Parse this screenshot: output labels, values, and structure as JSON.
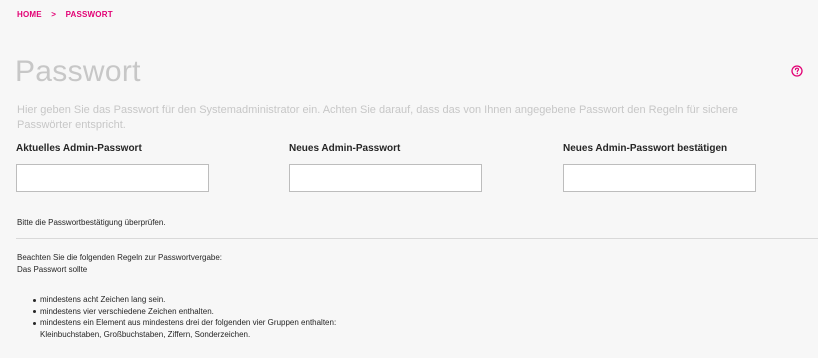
{
  "breadcrumb": {
    "home": "HOME",
    "separator": ">",
    "current": "PASSWORT"
  },
  "page": {
    "title": "Passwort",
    "intro": "Hier geben Sie das Passwort für den Systemadministrator ein. Achten Sie darauf, dass das von Ihnen angegebene Passwort den Regeln für sichere Passwörter entspricht.",
    "help_icon": "question-circle-icon"
  },
  "form": {
    "current_label": "Aktuelles Admin-Passwort",
    "current_value": "",
    "new_label": "Neues Admin-Passwort",
    "new_value": "",
    "confirm_label": "Neues Admin-Passwort bestätigen",
    "confirm_value": "",
    "error": "Bitte die Passwortbestätigung überprüfen."
  },
  "rules": {
    "intro_line1": "Beachten Sie die folgenden Regeln zur Passwortvergabe:",
    "intro_line2": "Das Passwort sollte",
    "items": [
      "mindestens acht Zeichen lang sein.",
      "mindestens vier verschiedene Zeichen enthalten.",
      "mindestens ein Element aus mindestens drei der folgenden vier Gruppen enthalten:",
      "Kleinbuchstaben, Großbuchstaben, Ziffern, Sonderzeichen."
    ]
  },
  "colors": {
    "accent": "#e20074",
    "title": "#c7c7c7",
    "background": "#f7f7f7"
  }
}
